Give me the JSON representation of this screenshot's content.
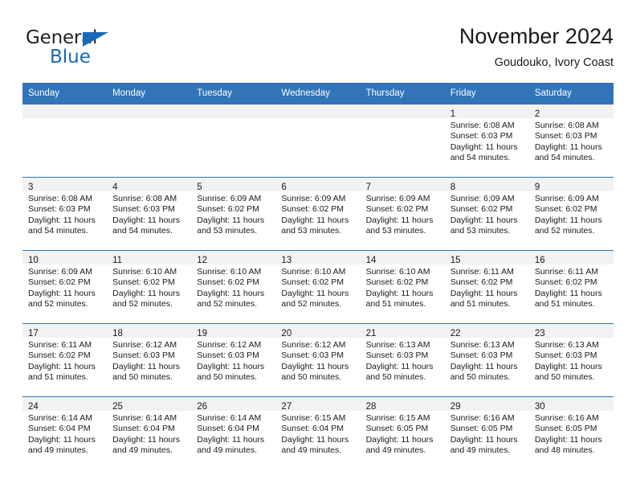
{
  "brand": {
    "word1": "General",
    "word2": "Blue",
    "triangle_color": "#1a69b4",
    "logo_icon": "triangle-icon"
  },
  "header": {
    "title": "November 2024",
    "subtitle": "Goudouko, Ivory Coast"
  },
  "calendar": {
    "header_bg": "#3174b8",
    "header_text_color": "#ffffff",
    "daynum_band_bg": "#f2f2f2",
    "weekdays": [
      "Sunday",
      "Monday",
      "Tuesday",
      "Wednesday",
      "Thursday",
      "Friday",
      "Saturday"
    ],
    "weeks": [
      [
        {
          "day": "",
          "empty": true
        },
        {
          "day": "",
          "empty": true
        },
        {
          "day": "",
          "empty": true
        },
        {
          "day": "",
          "empty": true
        },
        {
          "day": "",
          "empty": true
        },
        {
          "day": "1",
          "sunrise": "Sunrise: 6:08 AM",
          "sunset": "Sunset: 6:03 PM",
          "daylight1": "Daylight: 11 hours",
          "daylight2": "and 54 minutes."
        },
        {
          "day": "2",
          "sunrise": "Sunrise: 6:08 AM",
          "sunset": "Sunset: 6:03 PM",
          "daylight1": "Daylight: 11 hours",
          "daylight2": "and 54 minutes."
        }
      ],
      [
        {
          "day": "3",
          "sunrise": "Sunrise: 6:08 AM",
          "sunset": "Sunset: 6:03 PM",
          "daylight1": "Daylight: 11 hours",
          "daylight2": "and 54 minutes."
        },
        {
          "day": "4",
          "sunrise": "Sunrise: 6:08 AM",
          "sunset": "Sunset: 6:03 PM",
          "daylight1": "Daylight: 11 hours",
          "daylight2": "and 54 minutes."
        },
        {
          "day": "5",
          "sunrise": "Sunrise: 6:09 AM",
          "sunset": "Sunset: 6:02 PM",
          "daylight1": "Daylight: 11 hours",
          "daylight2": "and 53 minutes."
        },
        {
          "day": "6",
          "sunrise": "Sunrise: 6:09 AM",
          "sunset": "Sunset: 6:02 PM",
          "daylight1": "Daylight: 11 hours",
          "daylight2": "and 53 minutes."
        },
        {
          "day": "7",
          "sunrise": "Sunrise: 6:09 AM",
          "sunset": "Sunset: 6:02 PM",
          "daylight1": "Daylight: 11 hours",
          "daylight2": "and 53 minutes."
        },
        {
          "day": "8",
          "sunrise": "Sunrise: 6:09 AM",
          "sunset": "Sunset: 6:02 PM",
          "daylight1": "Daylight: 11 hours",
          "daylight2": "and 53 minutes."
        },
        {
          "day": "9",
          "sunrise": "Sunrise: 6:09 AM",
          "sunset": "Sunset: 6:02 PM",
          "daylight1": "Daylight: 11 hours",
          "daylight2": "and 52 minutes."
        }
      ],
      [
        {
          "day": "10",
          "sunrise": "Sunrise: 6:09 AM",
          "sunset": "Sunset: 6:02 PM",
          "daylight1": "Daylight: 11 hours",
          "daylight2": "and 52 minutes."
        },
        {
          "day": "11",
          "sunrise": "Sunrise: 6:10 AM",
          "sunset": "Sunset: 6:02 PM",
          "daylight1": "Daylight: 11 hours",
          "daylight2": "and 52 minutes."
        },
        {
          "day": "12",
          "sunrise": "Sunrise: 6:10 AM",
          "sunset": "Sunset: 6:02 PM",
          "daylight1": "Daylight: 11 hours",
          "daylight2": "and 52 minutes."
        },
        {
          "day": "13",
          "sunrise": "Sunrise: 6:10 AM",
          "sunset": "Sunset: 6:02 PM",
          "daylight1": "Daylight: 11 hours",
          "daylight2": "and 52 minutes."
        },
        {
          "day": "14",
          "sunrise": "Sunrise: 6:10 AM",
          "sunset": "Sunset: 6:02 PM",
          "daylight1": "Daylight: 11 hours",
          "daylight2": "and 51 minutes."
        },
        {
          "day": "15",
          "sunrise": "Sunrise: 6:11 AM",
          "sunset": "Sunset: 6:02 PM",
          "daylight1": "Daylight: 11 hours",
          "daylight2": "and 51 minutes."
        },
        {
          "day": "16",
          "sunrise": "Sunrise: 6:11 AM",
          "sunset": "Sunset: 6:02 PM",
          "daylight1": "Daylight: 11 hours",
          "daylight2": "and 51 minutes."
        }
      ],
      [
        {
          "day": "17",
          "sunrise": "Sunrise: 6:11 AM",
          "sunset": "Sunset: 6:02 PM",
          "daylight1": "Daylight: 11 hours",
          "daylight2": "and 51 minutes."
        },
        {
          "day": "18",
          "sunrise": "Sunrise: 6:12 AM",
          "sunset": "Sunset: 6:03 PM",
          "daylight1": "Daylight: 11 hours",
          "daylight2": "and 50 minutes."
        },
        {
          "day": "19",
          "sunrise": "Sunrise: 6:12 AM",
          "sunset": "Sunset: 6:03 PM",
          "daylight1": "Daylight: 11 hours",
          "daylight2": "and 50 minutes."
        },
        {
          "day": "20",
          "sunrise": "Sunrise: 6:12 AM",
          "sunset": "Sunset: 6:03 PM",
          "daylight1": "Daylight: 11 hours",
          "daylight2": "and 50 minutes."
        },
        {
          "day": "21",
          "sunrise": "Sunrise: 6:13 AM",
          "sunset": "Sunset: 6:03 PM",
          "daylight1": "Daylight: 11 hours",
          "daylight2": "and 50 minutes."
        },
        {
          "day": "22",
          "sunrise": "Sunrise: 6:13 AM",
          "sunset": "Sunset: 6:03 PM",
          "daylight1": "Daylight: 11 hours",
          "daylight2": "and 50 minutes."
        },
        {
          "day": "23",
          "sunrise": "Sunrise: 6:13 AM",
          "sunset": "Sunset: 6:03 PM",
          "daylight1": "Daylight: 11 hours",
          "daylight2": "and 50 minutes."
        }
      ],
      [
        {
          "day": "24",
          "sunrise": "Sunrise: 6:14 AM",
          "sunset": "Sunset: 6:04 PM",
          "daylight1": "Daylight: 11 hours",
          "daylight2": "and 49 minutes."
        },
        {
          "day": "25",
          "sunrise": "Sunrise: 6:14 AM",
          "sunset": "Sunset: 6:04 PM",
          "daylight1": "Daylight: 11 hours",
          "daylight2": "and 49 minutes."
        },
        {
          "day": "26",
          "sunrise": "Sunrise: 6:14 AM",
          "sunset": "Sunset: 6:04 PM",
          "daylight1": "Daylight: 11 hours",
          "daylight2": "and 49 minutes."
        },
        {
          "day": "27",
          "sunrise": "Sunrise: 6:15 AM",
          "sunset": "Sunset: 6:04 PM",
          "daylight1": "Daylight: 11 hours",
          "daylight2": "and 49 minutes."
        },
        {
          "day": "28",
          "sunrise": "Sunrise: 6:15 AM",
          "sunset": "Sunset: 6:05 PM",
          "daylight1": "Daylight: 11 hours",
          "daylight2": "and 49 minutes."
        },
        {
          "day": "29",
          "sunrise": "Sunrise: 6:16 AM",
          "sunset": "Sunset: 6:05 PM",
          "daylight1": "Daylight: 11 hours",
          "daylight2": "and 49 minutes."
        },
        {
          "day": "30",
          "sunrise": "Sunrise: 6:16 AM",
          "sunset": "Sunset: 6:05 PM",
          "daylight1": "Daylight: 11 hours",
          "daylight2": "and 48 minutes."
        }
      ]
    ]
  }
}
